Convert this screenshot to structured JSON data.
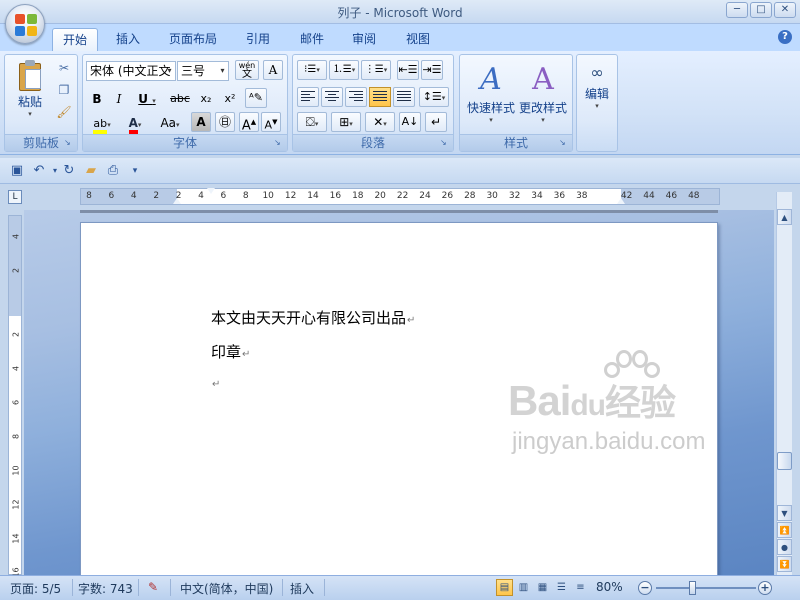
{
  "window": {
    "title": "列子 - Microsoft Word",
    "controls": {
      "minimize": "─",
      "maximize": "□",
      "close": "✕"
    }
  },
  "tabs": [
    {
      "label": "开始",
      "active": true
    },
    {
      "label": "插入"
    },
    {
      "label": "页面布局"
    },
    {
      "label": "引用"
    },
    {
      "label": "邮件"
    },
    {
      "label": "审阅"
    },
    {
      "label": "视图"
    }
  ],
  "ribbon": {
    "clipboard": {
      "label": "剪贴板",
      "paste": "粘贴"
    },
    "font": {
      "label": "字体",
      "font_name": "宋体 (中文正文",
      "font_size": "三号",
      "bold": "B",
      "italic": "I",
      "underline": "U",
      "strike": "abc",
      "subscript": "x₂",
      "superscript": "x²",
      "font_color": "A",
      "change_case": "Aa",
      "grow": "A",
      "shrink": "A",
      "pinyin": "wén",
      "pinyin_char": "文"
    },
    "paragraph": {
      "label": "段落"
    },
    "styles": {
      "label": "样式",
      "quick_styles": "快速样式",
      "change_styles": "更改样式"
    },
    "editing": {
      "label": "编辑",
      "find_label": "编辑"
    }
  },
  "ruler": {
    "numbers": [
      "8",
      "6",
      "4",
      "2",
      "2",
      "4",
      "6",
      "8",
      "10",
      "12",
      "14",
      "16",
      "18",
      "20",
      "22",
      "24",
      "26",
      "28",
      "30",
      "32",
      "34",
      "36",
      "38",
      "42",
      "44",
      "46",
      "48"
    ],
    "v_numbers": [
      "4",
      "2",
      "2",
      "4",
      "6",
      "8",
      "10",
      "12",
      "14",
      "16"
    ]
  },
  "document": {
    "lines": [
      "本文由天天开心有限公司出品",
      "印章",
      ""
    ],
    "para_mark": "↵"
  },
  "watermark": {
    "main": "Bai",
    "du": "du",
    "brand": "经验",
    "sub": "jingyan.baidu.com"
  },
  "status": {
    "page": "页面: 5/5",
    "words": "字数: 743",
    "language": "中文(简体，中国)",
    "mode": "插入",
    "zoom": "80%"
  },
  "colors": {
    "accent": "#15428b",
    "highlight": "#ffff00",
    "font_color": "#ff0000"
  }
}
